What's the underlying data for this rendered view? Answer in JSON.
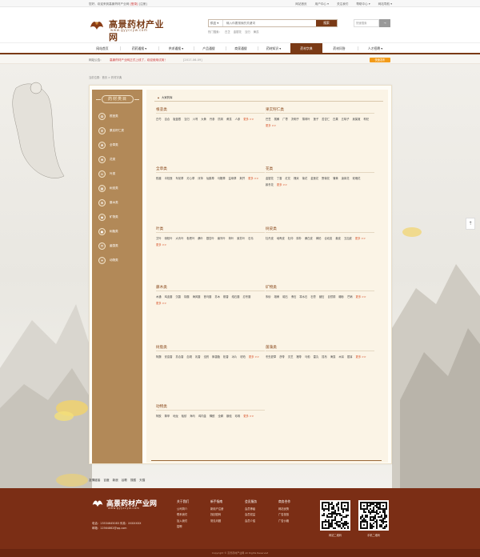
{
  "topbar": {
    "welcome": "您好，欢迎来到高景药材产业网",
    "login": "[登录]",
    "register": "[注册]",
    "right": [
      "网站首页",
      "用户中心 ▾",
      "关注我们",
      "帮助中心 ▾",
      "网站导航 ▾"
    ]
  },
  "logo": {
    "name": "高景药材产业网",
    "domain": "www.gyyccyw.com"
  },
  "search": {
    "select": "供应 ▾",
    "placeholder": "输入你要搜索的关键词",
    "button": "搜索",
    "hot": [
      "热门搜索：",
      "白芷",
      "金银花",
      "当归",
      "黄芪"
    ]
  },
  "login_box": {
    "placeholder": "快速搜索",
    "button": "→"
  },
  "nav": [
    "网站首页",
    "药药通搜 ▾",
    "供求通搜 ▾",
    "产品通搜",
    "商家通搜",
    "药材知识 ▾",
    "药材字典",
    "药材问答",
    "人才招聘 ▾"
  ],
  "notice": {
    "label": "网站公告:",
    "text": "高景药材产业网正式上线了，欢迎使用试用！",
    "date": "[2017-06-09]",
    "badge": "快速发布"
  },
  "breadcrumb": "当前位置：首页 > 药材字典",
  "sidebar": {
    "title": "药材类目",
    "items": [
      {
        "label": "根茎类",
        "icon": "root-icon"
      },
      {
        "label": "果实籽仁类",
        "icon": "fruit-icon"
      },
      {
        "label": "全草类",
        "icon": "grass-icon"
      },
      {
        "label": "花类",
        "icon": "flower-icon"
      },
      {
        "label": "叶类",
        "icon": "leaf-icon"
      },
      {
        "label": "树皮类",
        "icon": "bark-icon"
      },
      {
        "label": "藤木类",
        "icon": "vine-icon"
      },
      {
        "label": "矿物类",
        "icon": "mineral-icon"
      },
      {
        "label": "树脂类",
        "icon": "resin-icon"
      },
      {
        "label": "菌藻类",
        "icon": "fungus-icon"
      },
      {
        "label": "动物类",
        "icon": "animal-icon"
      }
    ]
  },
  "main": {
    "crumb": "大家药库",
    "categories": [
      {
        "title": "根茎类",
        "rows": [
          "白芍",
          "百合",
          "板蓝根",
          "当归",
          "川芎",
          "大黄",
          "丹参",
          "防风",
          "黄芪",
          "人参"
        ],
        "more": "更多 >>"
      },
      {
        "title": "果实籽仁类",
        "rows": [
          "巴豆",
          "槟榔",
          "广枣",
          "决明子",
          "薄荷叶",
          "莲子",
          "苦杏仁",
          "白果",
          "五味子",
          "吴茱萸",
          "枸杞"
        ],
        "more": "更多 >>"
      },
      {
        "title": "全草类",
        "rows": [
          "败酱",
          "半枝莲",
          "车前草",
          "灯心草",
          "浮萍",
          "仙鹤草",
          "马鞭草",
          "益母草",
          "荆芥"
        ],
        "more": "更多 >>"
      },
      {
        "title": "花类",
        "rows": [
          "金银花",
          "丁香",
          "红花",
          "槐米",
          "菊花",
          "金莲花",
          "野菊花",
          "蒲黄",
          "凌霄花",
          "玫瑰花",
          "款冬花"
        ],
        "more": "更多 >>"
      },
      {
        "title": "叶类",
        "rows": [
          "艾叶",
          "侧柏叶",
          "大青叶",
          "枇杷叶",
          "桑叶",
          "银杏叶",
          "番泻叶",
          "荷叶",
          "紫苏叶",
          "石韦"
        ],
        "more": "更多 >>"
      },
      {
        "title": "树皮类",
        "rows": [
          "牡丹皮",
          "地骨皮",
          "杜仲",
          "厚朴",
          "桑白皮",
          "黄柏",
          "合欢皮",
          "秦皮",
          "五加皮"
        ],
        "more": "更多 >>"
      },
      {
        "title": "藤木类",
        "rows": [
          "木通",
          "鸡血藤",
          "沉香",
          "钩藤",
          "海风藤",
          "首乌藤",
          "苏木",
          "檀香",
          "络石藤",
          "忍冬藤"
        ],
        "more": "更多 >>"
      },
      {
        "title": "矿物类",
        "rows": [
          "朱砂",
          "雄黄",
          "磁石",
          "滑石",
          "寒水石",
          "石膏",
          "赭石",
          "自然铜",
          "硼砂",
          "芒硝"
        ],
        "more": "更多 >>"
      },
      {
        "title": "树脂类",
        "rows": [
          "阿魏",
          "安息香",
          "苏合香",
          "血竭",
          "乳香",
          "没药",
          "枫香脂",
          "松香",
          "冰片",
          "琥珀"
        ],
        "more": "更多 >>"
      },
      {
        "title": "菌藻类",
        "rows": [
          "冬虫夏草",
          "茯苓",
          "灵芝",
          "猪苓",
          "马勃",
          "雷丸",
          "昆布",
          "海藻",
          "木耳",
          "银耳"
        ],
        "more": "更多 >>"
      },
      {
        "title": "动物类",
        "rows": [
          "阿胶",
          "鳖甲",
          "地龙",
          "蛤蚧",
          "海马",
          "鸡内金",
          "蝉蜕",
          "全蝎",
          "蜈蚣",
          "珍珠"
        ],
        "more": "更多 >>"
      }
    ]
  },
  "links": [
    "友情链接",
    "百度",
    "新浪",
    "谷歌",
    "搜狐",
    "天猫"
  ],
  "footer": {
    "phone": "电话：13534645083  传真：XXXXXXX",
    "email": "邮箱：12564862@qq.com",
    "columns": [
      {
        "title": "关于我们",
        "items": [
          "公司简介",
          "联系我们",
          "加入我们",
          "招聘"
        ]
      },
      {
        "title": "新手指南",
        "items": [
          "新用户注册",
          "找回密码",
          "常见问题"
        ]
      },
      {
        "title": "会员服务",
        "items": [
          "会员等级",
          "会员权益",
          "会员介绍"
        ]
      },
      {
        "title": "商务合作",
        "items": [
          "网站优势",
          "广告投放",
          "广告价格"
        ]
      }
    ],
    "qr1": "网站二维码",
    "qr2": "手机二维码",
    "copyright": "Copyright © 高景药材产业网 All Rights Reserved"
  }
}
